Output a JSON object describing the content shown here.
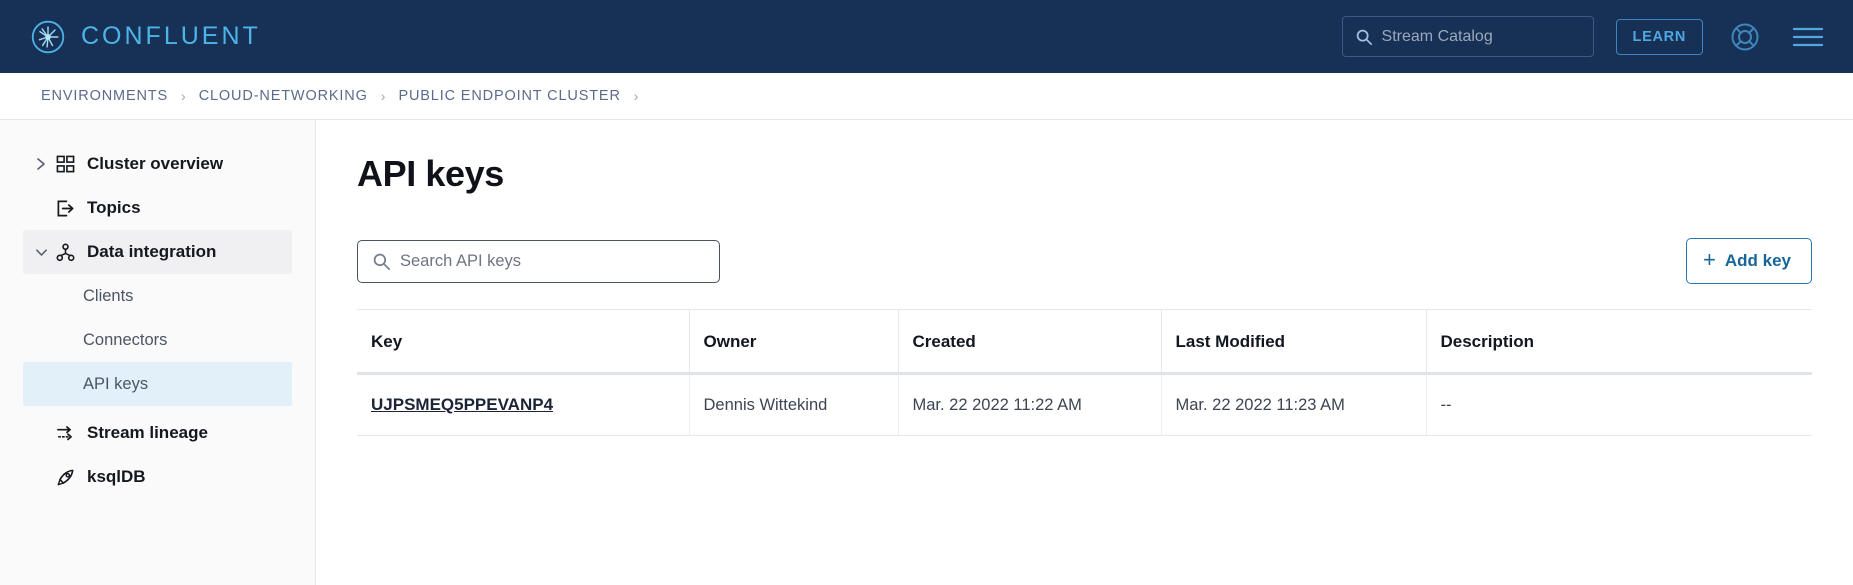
{
  "topnav": {
    "brand_name": "CONFLUENT",
    "brand_icon": "confluent-starburst-logo",
    "search": {
      "icon": "search-icon",
      "placeholder": "Stream Catalog",
      "value": ""
    },
    "learn_label": "LEARN",
    "help_icon": "life-ring-help-icon",
    "menu_icon": "hamburger-menu-icon"
  },
  "breadcrumb": {
    "items": [
      {
        "label": "ENVIRONMENTS"
      },
      {
        "label": "CLOUD-NETWORKING"
      },
      {
        "label": "PUBLIC ENDPOINT CLUSTER"
      }
    ],
    "separator": "›"
  },
  "sidebar": {
    "items": [
      {
        "label": "Cluster overview",
        "icon": "grid-dashboard-icon",
        "chevron": "chevron-right-icon",
        "expanded": false,
        "selected": false
      },
      {
        "label": "Topics",
        "icon": "topic-export-icon",
        "chevron": null,
        "expanded": false,
        "selected": false
      },
      {
        "label": "Data integration",
        "icon": "data-integration-node-icon",
        "chevron": "chevron-down-icon",
        "expanded": true,
        "selected": false
      },
      {
        "label": "Stream lineage",
        "icon": "stream-lineage-arrows-icon",
        "chevron": null,
        "expanded": false,
        "selected": false
      },
      {
        "label": "ksqlDB",
        "icon": "ksqldb-rocket-icon",
        "chevron": null,
        "expanded": false,
        "selected": false
      }
    ],
    "sub_items": [
      {
        "label": "Clients",
        "selected": false
      },
      {
        "label": "Connectors",
        "selected": false
      },
      {
        "label": "API keys",
        "selected": true
      }
    ]
  },
  "main": {
    "title": "API keys",
    "search": {
      "icon": "search-icon",
      "placeholder": "Search API keys",
      "value": ""
    },
    "add_key": {
      "label": "Add key",
      "icon": "plus-icon",
      "plus": "+"
    },
    "table": {
      "columns": [
        "Key",
        "Owner",
        "Created",
        "Last Modified",
        "Description"
      ],
      "rows": [
        {
          "key": "UJPSMEQ5PPEVANP4",
          "owner": "Dennis Wittekind",
          "created": "Mar. 22 2022 11:22 AM",
          "last_modified": "Mar. 22 2022 11:23 AM",
          "description": "--"
        }
      ]
    }
  },
  "colors": {
    "navy_header": "#173055",
    "brand_cyan": "#4db4e8",
    "accent_blue": "#176699",
    "selected_sidebar": "#e1f0f9",
    "sidebar_bg": "#fafafa"
  }
}
